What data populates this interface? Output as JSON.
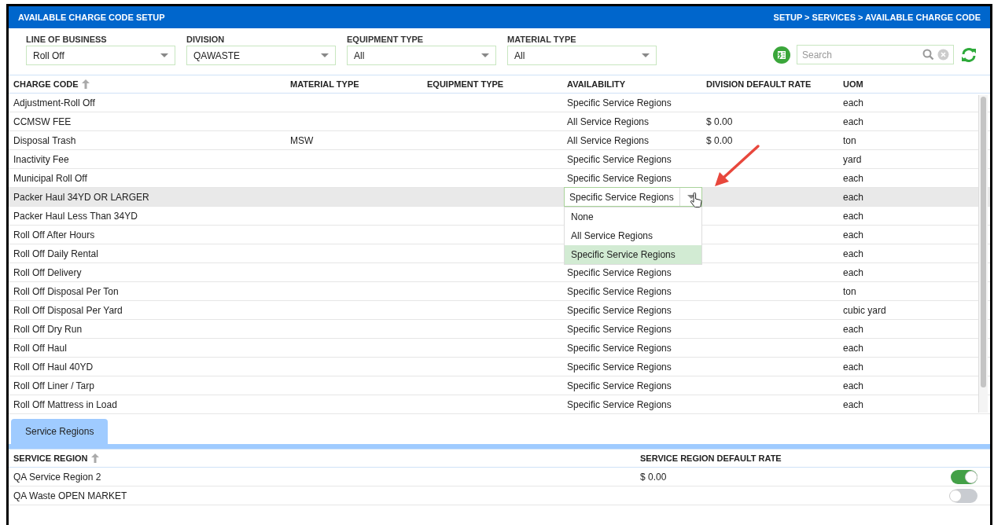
{
  "header": {
    "title": "AVAILABLE CHARGE CODE SETUP",
    "breadcrumb": "SETUP > SERVICES > AVAILABLE CHARGE CODE"
  },
  "filters": [
    {
      "label": "LINE OF BUSINESS",
      "value": "Roll Off"
    },
    {
      "label": "DIVISION",
      "value": "QAWASTE"
    },
    {
      "label": "EQUIPMENT TYPE",
      "value": "All"
    },
    {
      "label": "MATERIAL TYPE",
      "value": "All"
    }
  ],
  "search": {
    "placeholder": "Search"
  },
  "table": {
    "columns": [
      "CHARGE CODE",
      "MATERIAL TYPE",
      "EQUIPMENT TYPE",
      "AVAILABILITY",
      "DIVISION DEFAULT RATE",
      "UOM"
    ],
    "rows": [
      {
        "charge_code": "Adjustment-Roll Off",
        "material_type": "",
        "availability": "Specific Service Regions",
        "rate": "",
        "uom": "each",
        "selected": false
      },
      {
        "charge_code": "CCMSW FEE",
        "material_type": "",
        "availability": "All Service Regions",
        "rate": "$ 0.00",
        "uom": "each",
        "selected": false
      },
      {
        "charge_code": "Disposal Trash",
        "material_type": "MSW",
        "availability": "All Service Regions",
        "rate": "$ 0.00",
        "uom": "ton",
        "selected": false
      },
      {
        "charge_code": "Inactivity Fee",
        "material_type": "",
        "availability": "Specific Service Regions",
        "rate": "",
        "uom": "yard",
        "selected": false
      },
      {
        "charge_code": "Municipal Roll Off",
        "material_type": "",
        "availability": "Specific Service Regions",
        "rate": "",
        "uom": "each",
        "selected": false
      },
      {
        "charge_code": "Packer Haul 34YD OR LARGER",
        "material_type": "",
        "availability": "Specific Service Regions",
        "rate": "",
        "uom": "each",
        "selected": true,
        "options": [
          {
            "label": "None",
            "selected": false
          },
          {
            "label": "All Service Regions",
            "selected": false
          },
          {
            "label": "Specific Service Regions",
            "selected": true
          }
        ]
      },
      {
        "charge_code": "Packer Haul Less Than 34YD",
        "material_type": "",
        "rate": "",
        "uom": "each",
        "selected": false
      },
      {
        "charge_code": "Roll Off After Hours",
        "material_type": "",
        "rate": "",
        "uom": "each",
        "selected": false
      },
      {
        "charge_code": "Roll Off Daily Rental",
        "material_type": "",
        "rate": "",
        "uom": "each",
        "selected": false
      },
      {
        "charge_code": "Roll Off Delivery",
        "material_type": "",
        "availability": "Specific Service Regions",
        "rate": "",
        "uom": "each",
        "selected": false
      },
      {
        "charge_code": "Roll Off Disposal Per Ton",
        "material_type": "",
        "availability": "Specific Service Regions",
        "rate": "",
        "uom": "ton",
        "selected": false
      },
      {
        "charge_code": "Roll Off Disposal Per Yard",
        "material_type": "",
        "availability": "Specific Service Regions",
        "rate": "",
        "uom": "cubic yard",
        "selected": false
      },
      {
        "charge_code": "Roll Off Dry Run",
        "material_type": "",
        "availability": "Specific Service Regions",
        "rate": "",
        "uom": "each",
        "selected": false
      },
      {
        "charge_code": "Roll Off Haul",
        "material_type": "",
        "availability": "Specific Service Regions",
        "rate": "",
        "uom": "each",
        "selected": false
      },
      {
        "charge_code": "Roll Off Haul 40YD",
        "material_type": "",
        "availability": "Specific Service Regions",
        "rate": "",
        "uom": "each",
        "selected": false
      },
      {
        "charge_code": "Roll Off Liner / Tarp",
        "material_type": "",
        "availability": "Specific Service Regions",
        "rate": "",
        "uom": "each",
        "selected": false
      },
      {
        "charge_code": "Roll Off Mattress in Load",
        "material_type": "",
        "availability": "Specific Service Regions",
        "rate": "",
        "uom": "each",
        "selected": false
      }
    ]
  },
  "tabs": [
    {
      "label": "Service Regions",
      "selected": true
    }
  ],
  "regions": {
    "columns": [
      "SERVICE REGION",
      "SERVICE REGION DEFAULT RATE"
    ],
    "rows": [
      {
        "name": "QA Service Region 2",
        "rate": "$ 0.00",
        "on": true
      },
      {
        "name": "QA Waste OPEN MARKET",
        "rate": "",
        "on": false
      }
    ]
  }
}
